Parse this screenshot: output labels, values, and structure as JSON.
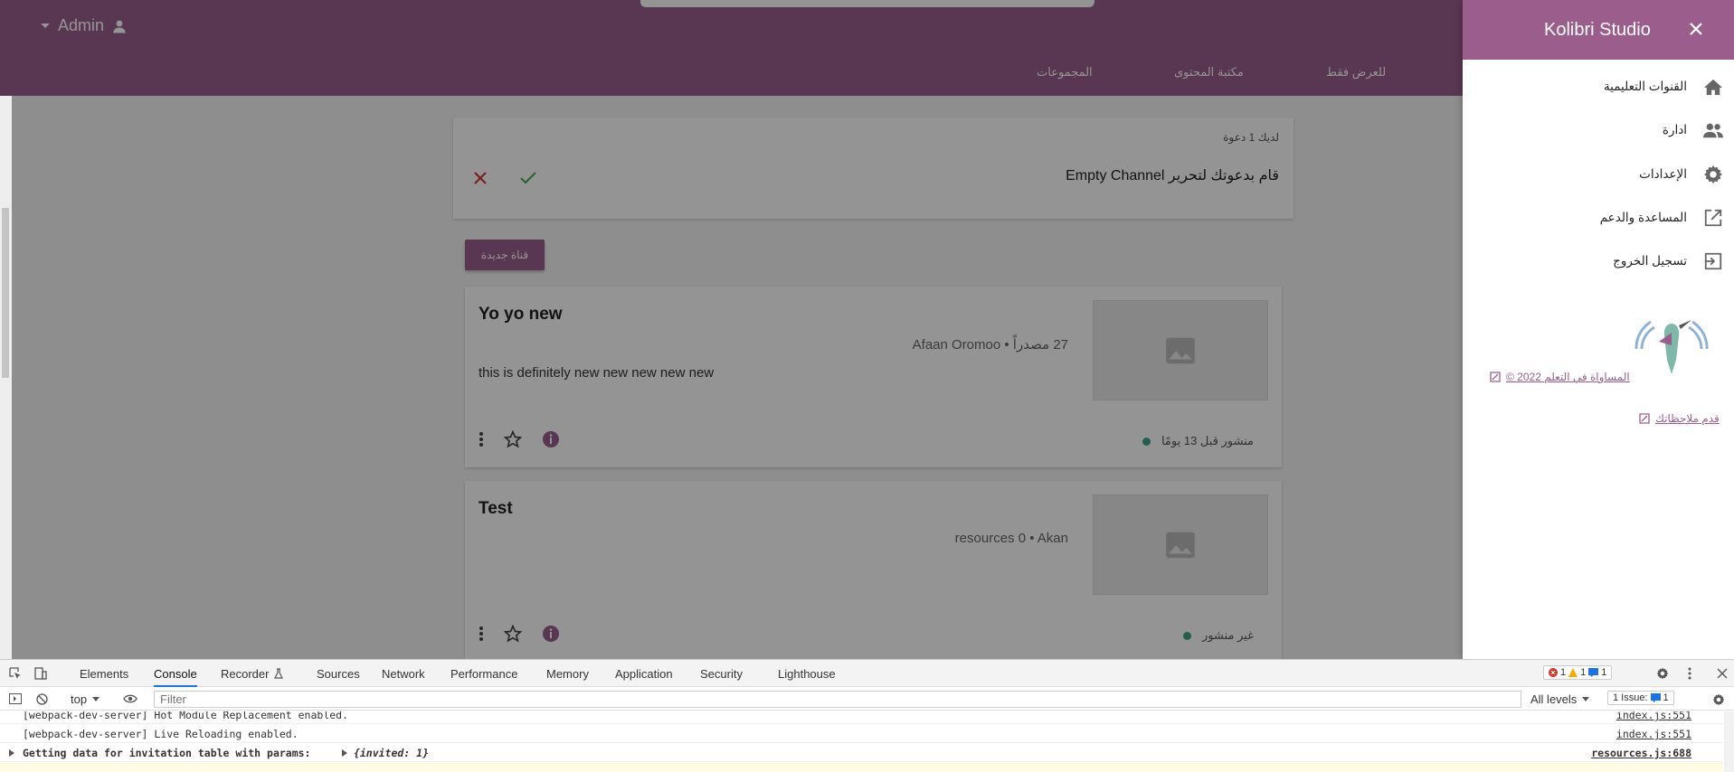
{
  "header": {
    "account_name": "Admin",
    "tabs": [
      "المجموعات",
      "مكتبة المحتوى",
      "للعرض فقط"
    ]
  },
  "invitation": {
    "count_text": "لديك 1 دعوة",
    "message": "قام بدعوتك لتحرير Empty Channel"
  },
  "new_channel_button": "قناة جديدة",
  "channels": [
    {
      "title": "Yo yo new",
      "meta": "27 مصدراً  •  Afaan Oromoo",
      "description": "this is definitely new new new new new",
      "status": "منشور قبل 13 يومًا"
    },
    {
      "title": "Test",
      "meta": "resources 0  •  Akan",
      "description": "",
      "status": "غير منشور"
    }
  ],
  "drawer": {
    "title": "Kolibri Studio",
    "items": [
      "القنوات التعليمية",
      "ادارة",
      "الإعدادات",
      "المساعدة والدعم",
      "تسجيل الخروج"
    ],
    "copyright": "© 2022 المساواة في التعلم",
    "feedback": "قدم ملاحظاتك"
  },
  "devtools": {
    "tabs": [
      "Elements",
      "Console",
      "Recorder",
      "Sources",
      "Network",
      "Performance",
      "Memory",
      "Application",
      "Security",
      "Lighthouse"
    ],
    "active_tab": "Console",
    "errors": "1",
    "warnings": "1",
    "infos": "1",
    "context": "top",
    "filter_placeholder": "Filter",
    "levels": "All levels",
    "issues": "1 Issue:",
    "issues_count": "1",
    "logs": [
      {
        "message": "[webpack-dev-server] Hot Module Replacement enabled.",
        "source": "index.js:551"
      },
      {
        "message": "[webpack-dev-server] Live Reloading enabled.",
        "source": "index.js:551"
      },
      {
        "message": "Getting data for invitation table with params:",
        "detail": "{invited: 1}",
        "source": "resources.js:688"
      }
    ]
  },
  "colors": {
    "brand": "#9a5d8c",
    "published_dot": "#3da38b",
    "reject": "#d32f2f",
    "accept": "#4caf50"
  }
}
